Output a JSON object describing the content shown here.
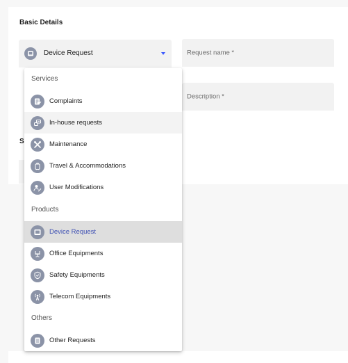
{
  "form": {
    "section_title": "Basic Details",
    "request_type_value": "Device Request",
    "request_name_label": "Request name *",
    "description_label": "Description *",
    "peek_letter": "S"
  },
  "menu": {
    "groups": {
      "services": "Services",
      "products": "Products",
      "others": "Others"
    },
    "items": [
      {
        "label": "Complaints",
        "icon": "complaint-icon"
      },
      {
        "label": "In-house requests",
        "icon": "chat-icon"
      },
      {
        "label": "Maintenance",
        "icon": "tools-icon"
      },
      {
        "label": "Travel & Accommodations",
        "icon": "luggage-icon"
      },
      {
        "label": "User Modifications",
        "icon": "user-edit-icon"
      },
      {
        "label": "Device Request",
        "icon": "device-icon"
      },
      {
        "label": "Office Equipments",
        "icon": "office-chair-icon"
      },
      {
        "label": "Safety Equipments",
        "icon": "shield-icon"
      },
      {
        "label": "Telecom Equipments",
        "icon": "antenna-icon"
      },
      {
        "label": "Other Requests",
        "icon": "document-icon"
      }
    ],
    "selected": "Device Request",
    "hovered": "In-house requests"
  },
  "colors": {
    "accent": "#3d5afe",
    "selected_text": "#3d4fb3",
    "icon_bg": "#8b93a7",
    "field_bg": "#f2f2f2"
  }
}
